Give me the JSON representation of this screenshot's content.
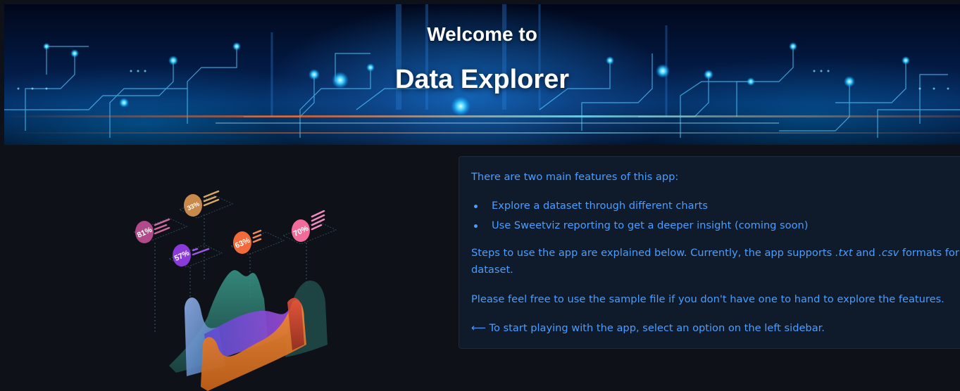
{
  "banner": {
    "title_line1": "Welcome to",
    "title_line2": "Data Explorer"
  },
  "illustration": {
    "badges": [
      "81%",
      "33%",
      "57%",
      "63%",
      "70%"
    ]
  },
  "info": {
    "intro": "There are two main features of this app:",
    "features": [
      "Explore a dataset through different charts",
      "Use Sweetviz reporting to get a deeper insight (coming soon)"
    ],
    "steps_part1": "Steps to use the app are explained below. Currently, the app supports ",
    "ext_txt": ".txt",
    "steps_and": " and ",
    "ext_csv": ".csv",
    "steps_part2": " formats for the",
    "steps_part3": "dataset.",
    "sample_note": "Please feel free to use the sample file if you don't have one to hand to explore the features.",
    "start_hint": "⟵ To start playing with the app, select an option on the left sidebar."
  },
  "colors": {
    "page_bg": "#0e1117",
    "card_bg": "#0f1a2b",
    "card_text": "#4a9eff"
  }
}
